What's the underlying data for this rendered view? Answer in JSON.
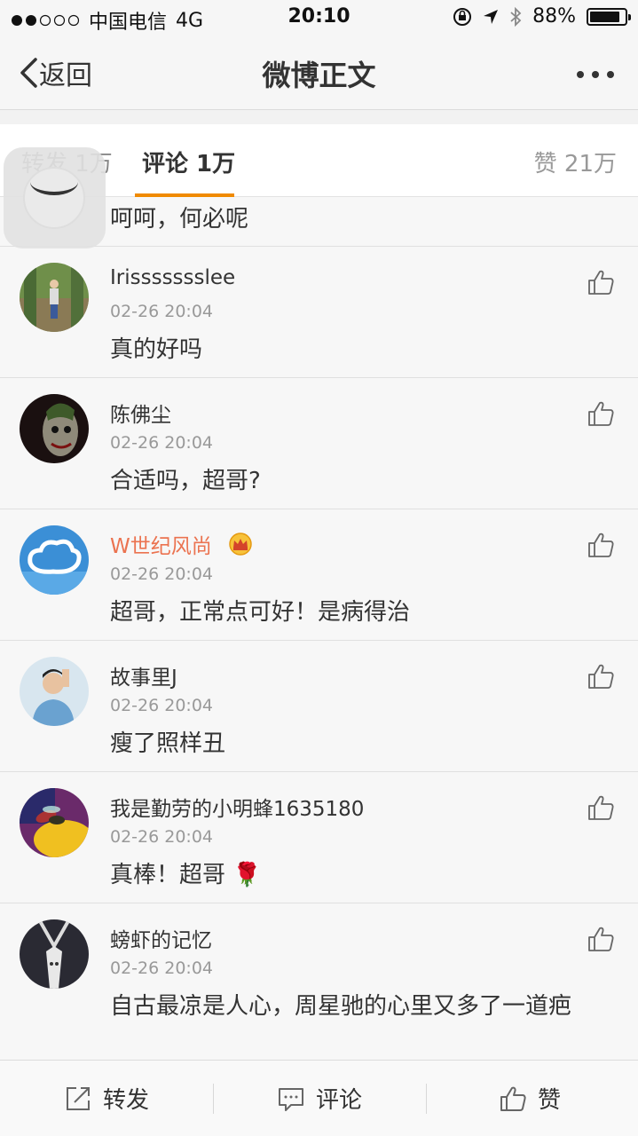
{
  "status": {
    "carrier": "中国电信",
    "network": "4G",
    "time": "20:10",
    "battery_text": "88%",
    "battery_level": 0.88
  },
  "nav": {
    "back_label": "返回",
    "title": "微博正文",
    "more": "···"
  },
  "tabs": {
    "repost": "转发 1万",
    "comment": "评论 1万",
    "like": "赞 21万"
  },
  "partial_comment": "呵呵，何必呢",
  "comments": [
    {
      "user": "Irissssssslee",
      "time": "02-26 20:04",
      "text": "真的好吗"
    },
    {
      "user": "陈佛尘",
      "time": "02-26 20:04",
      "text": "合适吗，超哥?"
    },
    {
      "user": "W世纪风尚",
      "time": "02-26 20:04",
      "text": "超哥，正常点可好！是病得治"
    },
    {
      "user": "故事里J",
      "time": "02-26 20:04",
      "text": "瘦了照样丑"
    },
    {
      "user": "我是勤劳的小明蜂1635180",
      "time": "02-26 20:04",
      "text": "真棒！超哥 🌹"
    },
    {
      "user": "螃虾的记忆",
      "time": "02-26 20:04",
      "text": "自古最凉是人心，周星驰的心里又多了一道疤"
    }
  ],
  "bottom": {
    "repost": "转发",
    "comment": "评论",
    "like": "赞"
  },
  "colors": {
    "accent": "#f08a00",
    "vip_name": "#eb7350"
  }
}
